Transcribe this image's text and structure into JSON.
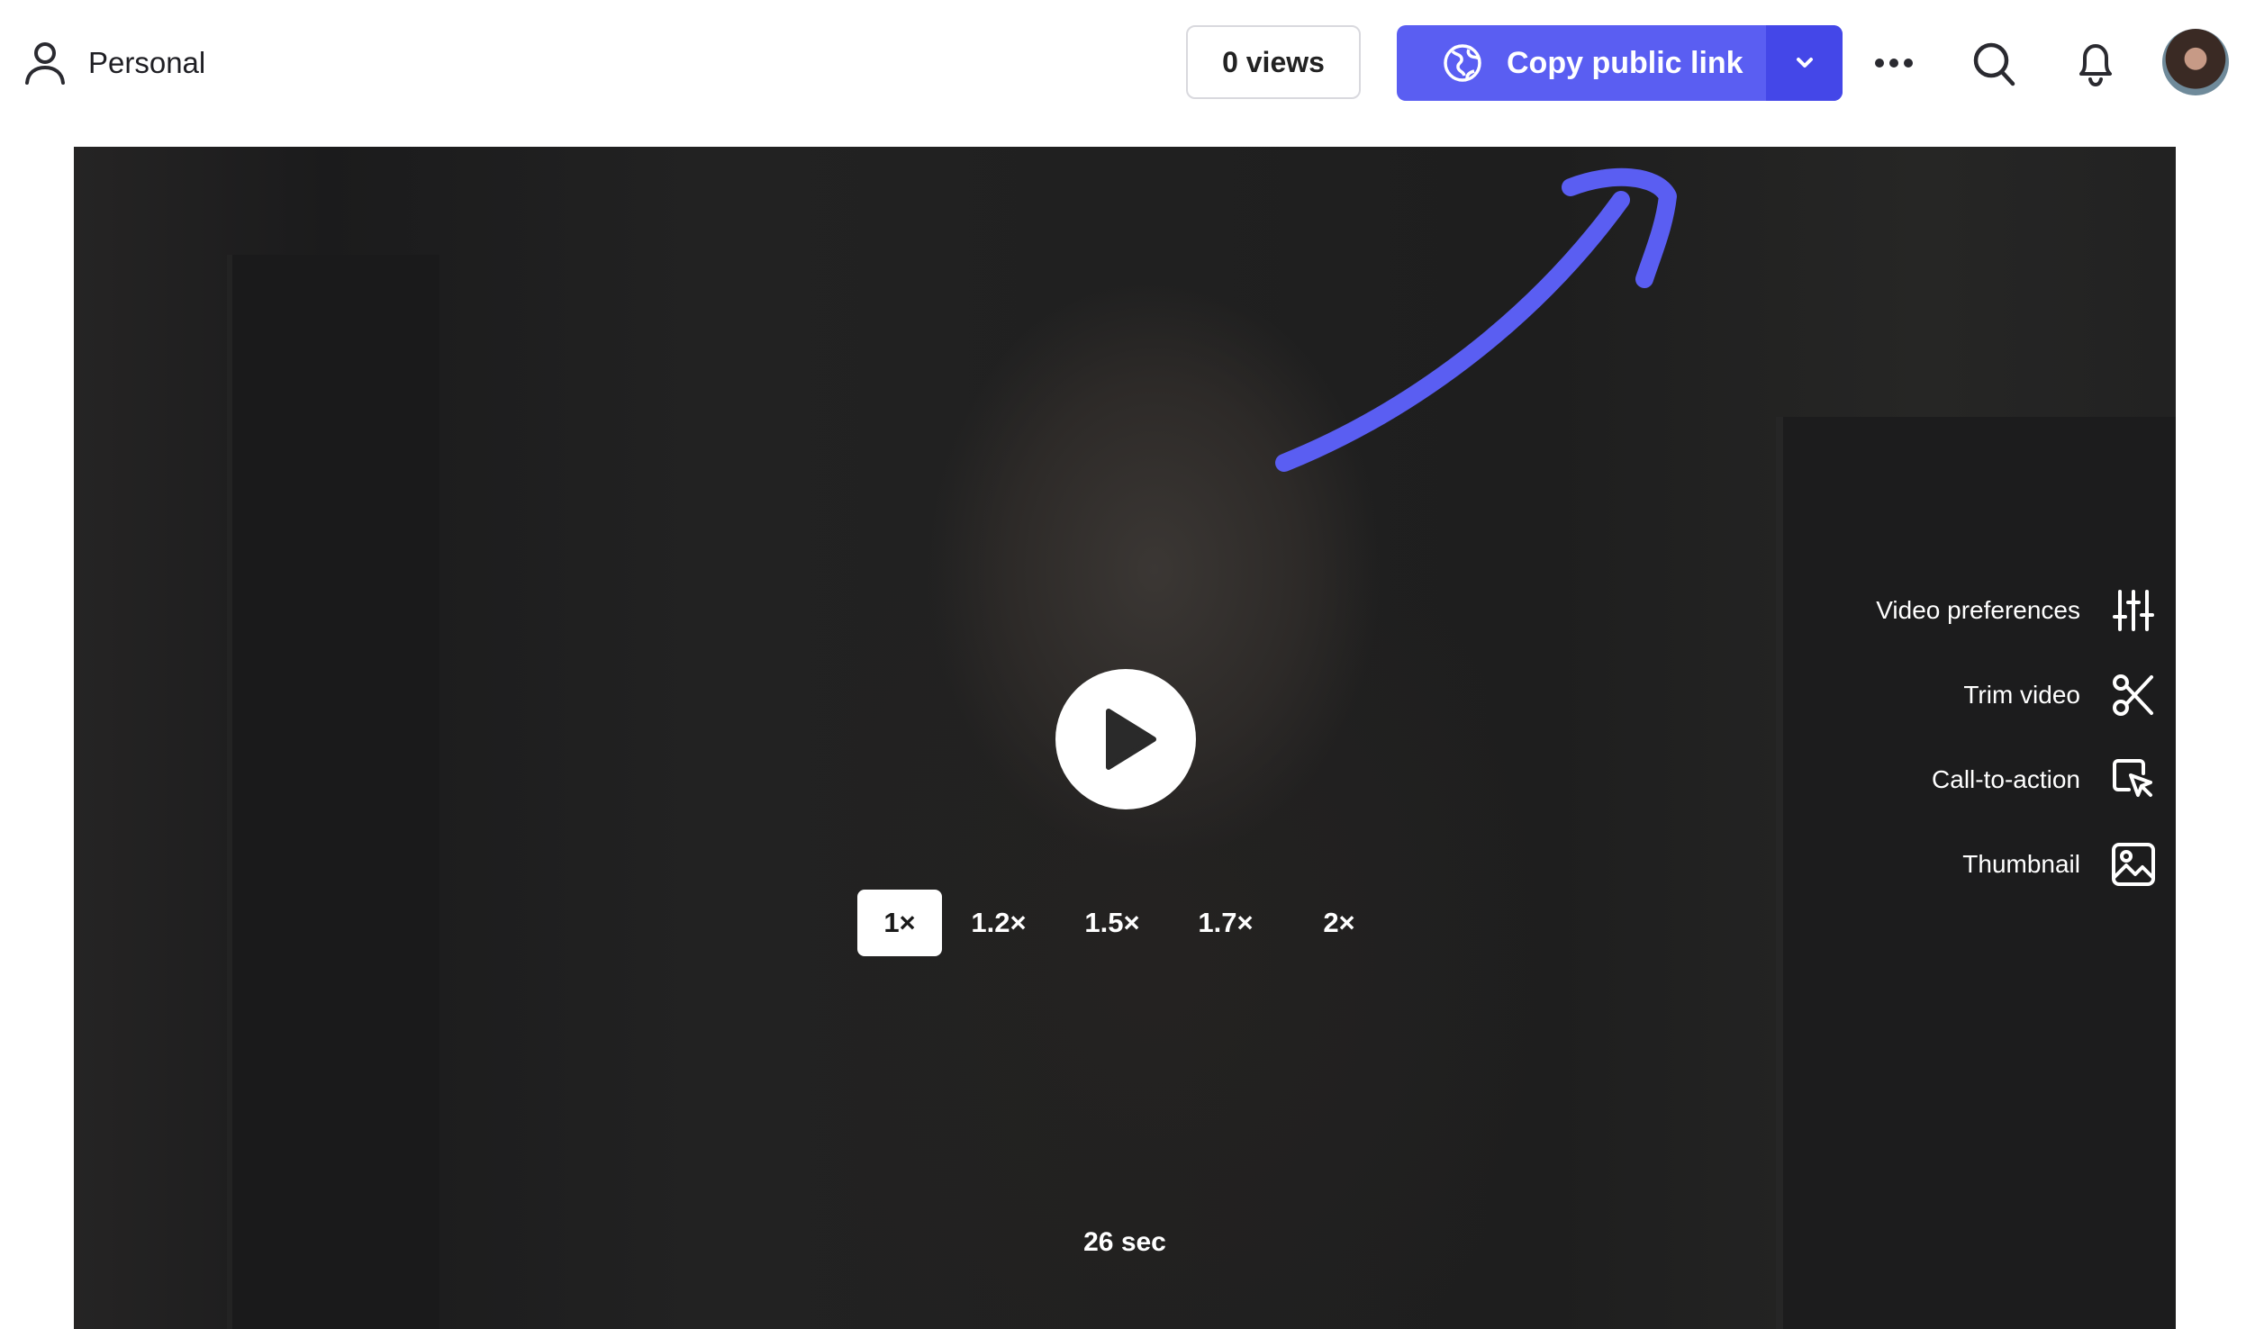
{
  "header": {
    "workspace_label": "Personal",
    "views_label": "0 views",
    "copy_link_label": "Copy public link"
  },
  "player": {
    "speeds": [
      "1×",
      "1.2×",
      "1.5×",
      "1.7×",
      "2×"
    ],
    "selected_speed": "1×",
    "duration": "26 sec"
  },
  "side_menu": {
    "items": [
      {
        "label": "Video preferences",
        "icon": "sliders-icon"
      },
      {
        "label": "Trim video",
        "icon": "scissors-icon"
      },
      {
        "label": "Call-to-action",
        "icon": "cursor-click-icon"
      },
      {
        "label": "Thumbnail",
        "icon": "image-icon"
      }
    ]
  },
  "colors": {
    "accent": "#5a5ef2",
    "accent_dark": "#4447e8",
    "video_bg": "#1e1e1f"
  }
}
